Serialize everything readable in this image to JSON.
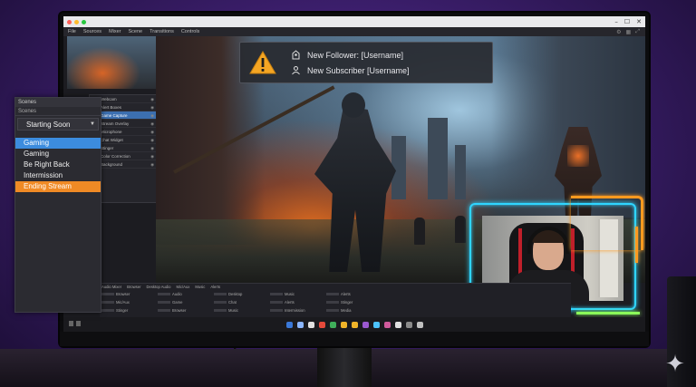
{
  "window": {
    "title": "",
    "controls": [
      "–",
      "☐",
      "✕"
    ]
  },
  "menu": {
    "items": [
      "File",
      "Sources",
      "Mixer",
      "Scene",
      "Transitions",
      "Controls"
    ]
  },
  "alert": {
    "follower": "New Follower: [Username]",
    "subscriber": "New Subscriber [Username]"
  },
  "scenes_panel": {
    "title": "Scenes",
    "subtitle": "Scenes",
    "selected": "Starting Soon",
    "items": [
      {
        "label": "Gaming",
        "state": "selected-blue"
      },
      {
        "label": "Gaming",
        "state": "normal"
      },
      {
        "label": "Be Right Back",
        "state": "normal"
      },
      {
        "label": "Intermission",
        "state": "normal"
      },
      {
        "label": "Ending Stream",
        "state": "selected-orange"
      }
    ]
  },
  "sources": {
    "rows": [
      "Webcam",
      "Alert Boxes",
      "Game Capture",
      "Stream Overlay",
      "Microphone",
      "Chat Widget",
      "Stinger",
      "Color Correction",
      "Background"
    ]
  },
  "mixer": {
    "headers": [
      "Audio Mixer",
      "Browser",
      "Desktop Audio",
      "Mic/Aux",
      "Music",
      "Alerts"
    ],
    "rows": [
      [
        "Browser",
        "Audio",
        "Desktop",
        "Music",
        "Alerts"
      ],
      [
        "Mic/Aux",
        "Game",
        "Chat",
        "Alerts",
        "Stinger"
      ],
      [
        "Stinger",
        "Browser",
        "Music",
        "Intermission",
        "Media"
      ]
    ]
  },
  "colors": {
    "scene_blue": "#3c8cde",
    "scene_orange": "#ef8a25",
    "webcam_cyan": "#2fd5ff",
    "webcam_orange": "#ff9a1f",
    "webcam_green": "#8bff5a",
    "alert_warning": "#f5a623"
  },
  "icons": {
    "alert": "warning-icon",
    "follower": "follower-icon",
    "subscriber": "subscriber-icon",
    "select": "chevron-down-icon",
    "watermark": "sparkle-icon"
  },
  "taskbar": {
    "icon_colors": [
      "#3a78d8",
      "#8bb6ff",
      "#e0e0e0",
      "#e64a3b",
      "#3fae5a",
      "#f0b429",
      "#f0b429",
      "#9b59d0",
      "#4cc3ff",
      "#d05a9b",
      "#e0e0e0",
      "#8a8a8a",
      "#c0c0c0"
    ]
  }
}
